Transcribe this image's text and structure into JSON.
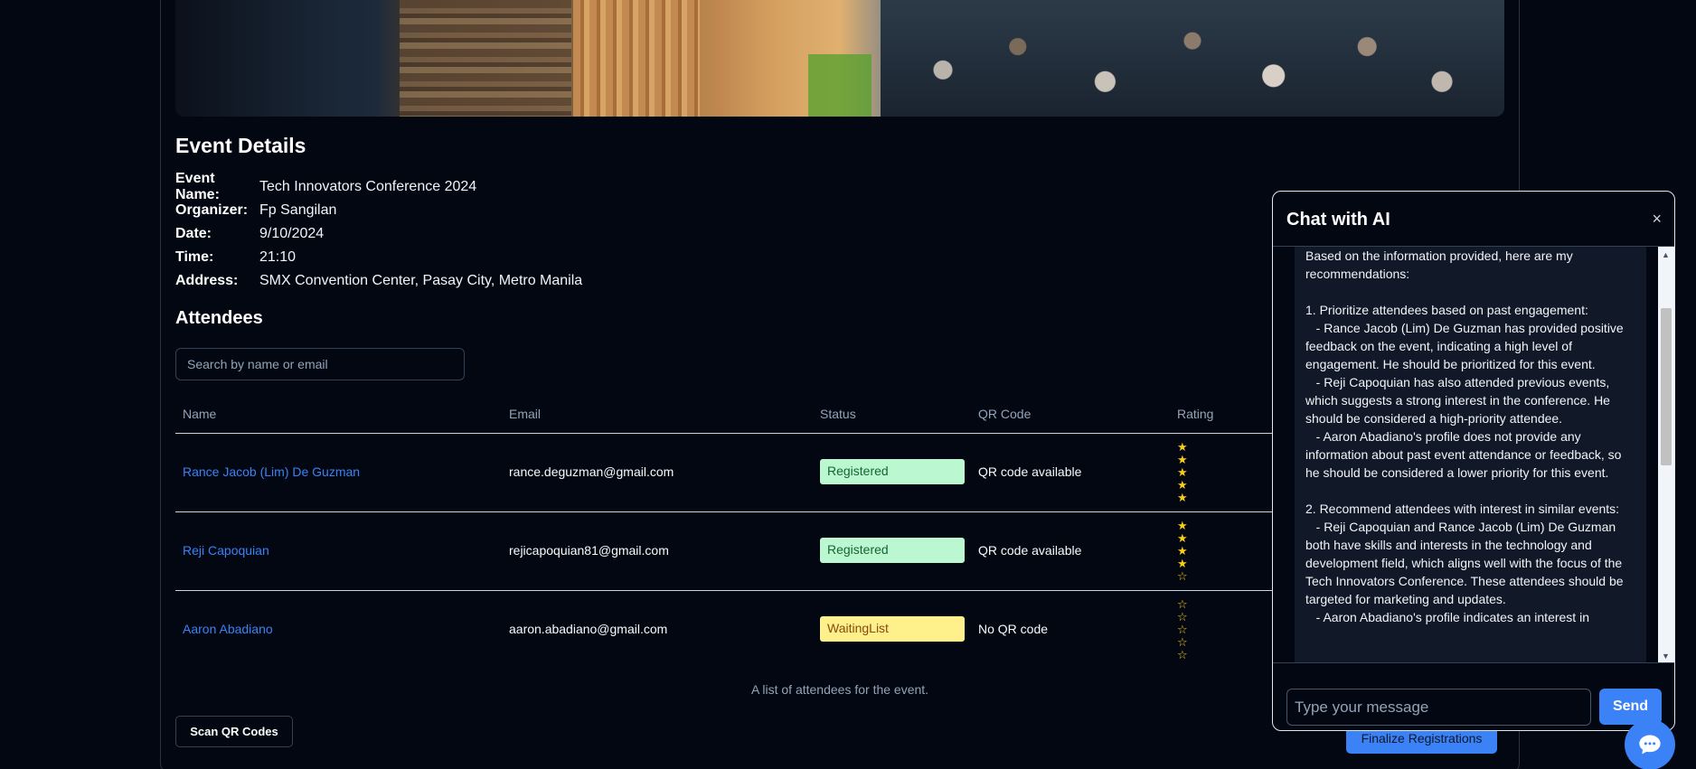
{
  "event_details": {
    "title": "Event Details",
    "rows": [
      {
        "label": "Event Name:",
        "value": "Tech Innovators Conference 2024"
      },
      {
        "label": "Organizer:",
        "value": "Fp Sangilan"
      },
      {
        "label": "Date:",
        "value": "9/10/2024"
      },
      {
        "label": "Time:",
        "value": "21:10"
      },
      {
        "label": "Address:",
        "value": "SMX Convention Center, Pasay City, Metro Manila"
      }
    ]
  },
  "attendees": {
    "title": "Attendees",
    "search_placeholder": "Search by name or email",
    "columns": {
      "name": "Name",
      "email": "Email",
      "status": "Status",
      "qr": "QR Code",
      "rating": "Rating"
    },
    "rows": [
      {
        "name": "Rance Jacob (Lim) De Guzman",
        "email": "rance.deguzman@gmail.com",
        "status": "Registered",
        "qr": "QR code available",
        "rating": 5
      },
      {
        "name": "Reji Capoquian",
        "email": "rejicapoquian81@gmail.com",
        "status": "Registered",
        "qr": "QR code available",
        "rating": 4
      },
      {
        "name": "Aaron Abadiano",
        "email": "aaron.abadiano@gmail.com",
        "status": "WaitingList",
        "qr": "No QR code",
        "rating": 0
      }
    ],
    "max_rating": 5,
    "caption": "A list of attendees for the event."
  },
  "buttons": {
    "scan": "Scan QR Codes",
    "finalize": "Finalize Registrations"
  },
  "chat": {
    "title": "Chat with AI",
    "close_icon": "×",
    "message": "Based on the information provided, here are my recommendations:\n\n1. Prioritize attendees based on past engagement:\n   - Rance Jacob (Lim) De Guzman has provided positive feedback on the event, indicating a high level of engagement. He should be prioritized for this event.\n   - Reji Capoquian has also attended previous events, which suggests a strong interest in the conference. He should be considered a high-priority attendee.\n   - Aaron Abadiano's profile does not provide any information about past event attendance or feedback, so he should be considered a lower priority for this event.\n\n2. Recommend attendees with interest in similar events:\n   - Reji Capoquian and Rance Jacob (Lim) De Guzman both have skills and interests in the technology and development field, which aligns well with the focus of the Tech Innovators Conference. These attendees should be targeted for marketing and updates.\n   - Aaron Abadiano's profile indicates an interest in",
    "input_placeholder": "Type your message",
    "send": "Send"
  },
  "colors": {
    "accent": "#3b82f6",
    "registered_bg": "#bbf7d0",
    "waiting_bg": "#fef08a",
    "star": "#facc15"
  }
}
